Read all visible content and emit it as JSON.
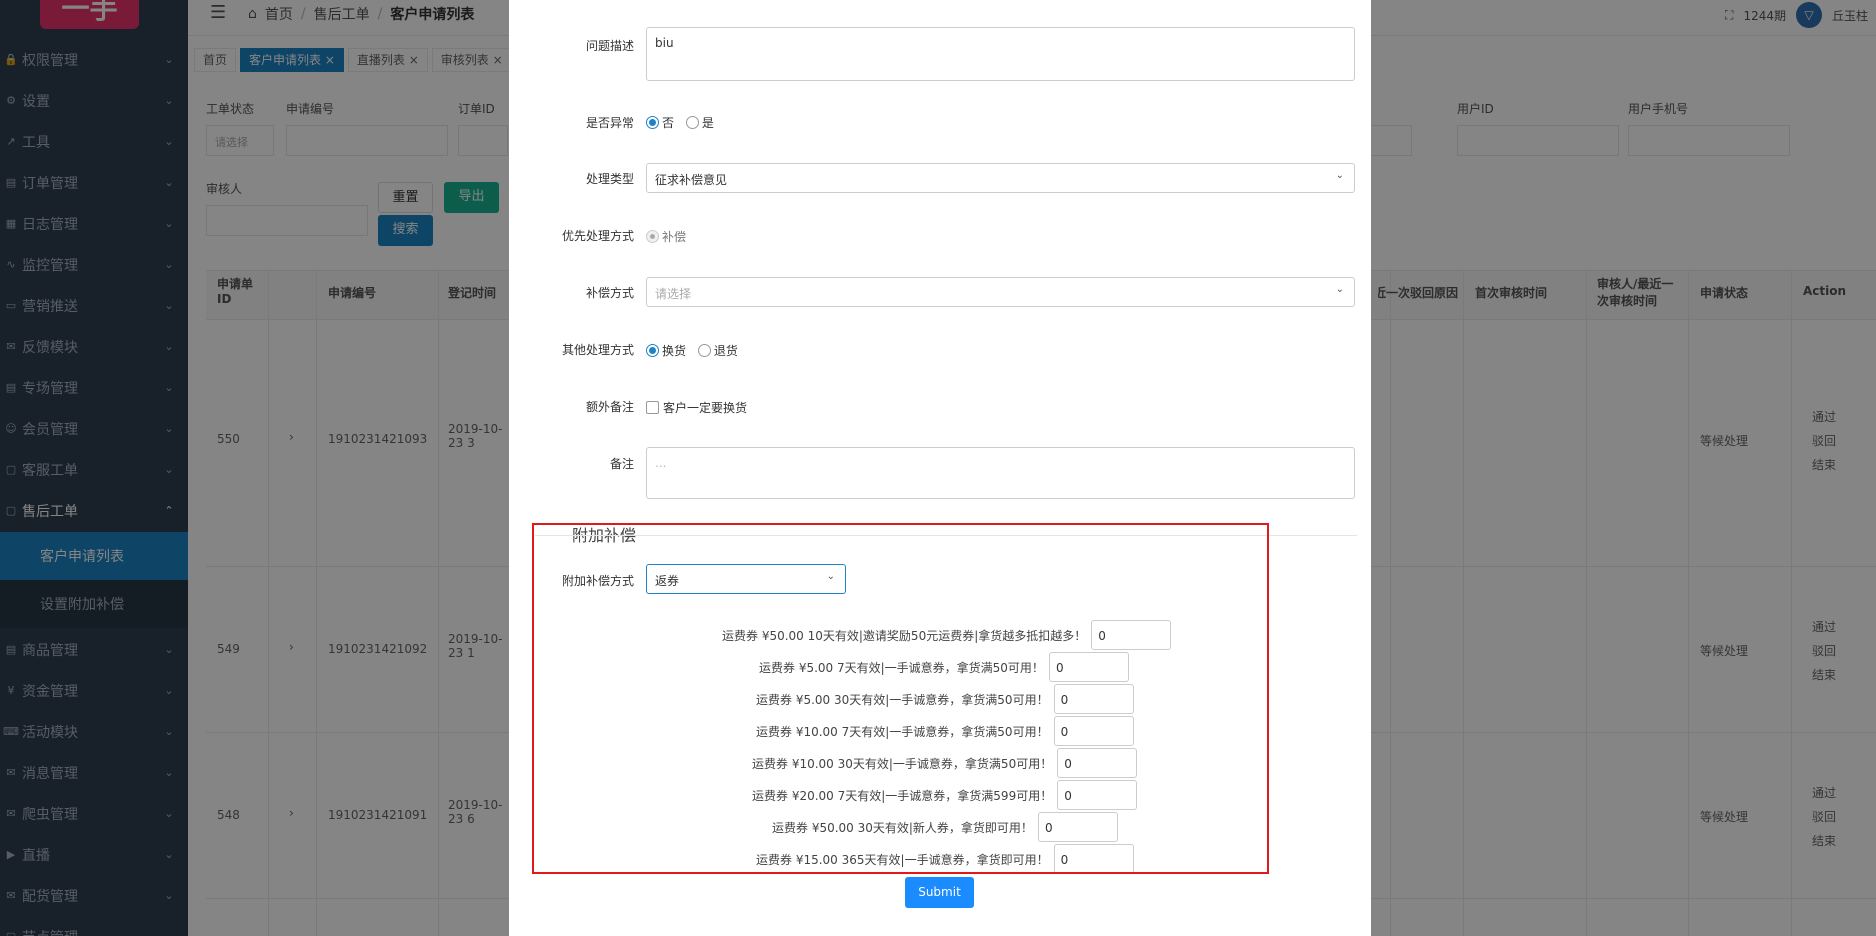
{
  "logo": "一手",
  "sidebar": {
    "items": [
      {
        "icon": "lock-icon",
        "glyph": "🔒",
        "label": "权限管理"
      },
      {
        "icon": "gear-icon",
        "glyph": "⚙",
        "label": "设置"
      },
      {
        "icon": "wrench-icon",
        "glyph": "↗",
        "label": "工具"
      },
      {
        "icon": "order-icon",
        "glyph": "▤",
        "label": "订单管理"
      },
      {
        "icon": "log-icon",
        "glyph": "▦",
        "label": "日志管理"
      },
      {
        "icon": "monitor-icon",
        "glyph": "∿",
        "label": "监控管理"
      },
      {
        "icon": "card-icon",
        "glyph": "▭",
        "label": "营销推送"
      },
      {
        "icon": "feedback-icon",
        "glyph": "✉",
        "label": "反馈模块"
      },
      {
        "icon": "venue-icon",
        "glyph": "▤",
        "label": "专场管理"
      },
      {
        "icon": "member-icon",
        "glyph": "☺",
        "label": "会员管理"
      },
      {
        "icon": "service-icon",
        "glyph": "▢",
        "label": "客服工单"
      },
      {
        "icon": "aftersale-icon",
        "glyph": "▢",
        "label": "售后工单"
      },
      {
        "icon": "goods-icon",
        "glyph": "▤",
        "label": "商品管理"
      },
      {
        "icon": "yen-icon",
        "glyph": "¥",
        "label": "资金管理"
      },
      {
        "icon": "gamepad-icon",
        "glyph": "⌨",
        "label": "活动模块"
      },
      {
        "icon": "message-icon",
        "glyph": "✉",
        "label": "消息管理"
      },
      {
        "icon": "crawler-icon",
        "glyph": "✉",
        "label": "爬虫管理"
      },
      {
        "icon": "live-icon",
        "glyph": "▶",
        "label": "直播"
      },
      {
        "icon": "delivery-icon",
        "glyph": "✉",
        "label": "配货管理"
      },
      {
        "icon": "more-icon",
        "glyph": "▢",
        "label": "节点管理"
      }
    ],
    "subitems": [
      {
        "label": "客户申请列表"
      },
      {
        "label": "设置附加补偿"
      }
    ]
  },
  "topbar": {
    "crumbs": [
      "首页",
      "售后工单",
      "客户申请列表"
    ],
    "period": "1244期",
    "user": "丘玉柱",
    "avatar_text": "▽"
  },
  "tabs": [
    "首页",
    "客户申请列表 ×",
    "直播列表 ×",
    "审核列表 ×"
  ],
  "filters": {
    "status_label": "工单状态",
    "status_placeholder": "请选择",
    "apply_no_label": "申请编号",
    "order_id_label": "订单ID",
    "user_id_label": "用户ID",
    "user_phone_label": "用户手机号",
    "reviewer_label": "审核人",
    "reset": "重置",
    "export": "导出",
    "search": "搜索"
  },
  "table": {
    "headers": [
      "申请单ID",
      "申请编号",
      "登记时间",
      "近一次驳回原因",
      "首次审核时间",
      "审核人/最近一次审核时间",
      "申请状态",
      "Action"
    ],
    "rows": [
      {
        "id": "550",
        "no": "1910231421093",
        "time": "2019-10-23 3",
        "status": "等候处理",
        "actions": [
          "通过",
          "驳回",
          "结束"
        ]
      },
      {
        "id": "549",
        "no": "1910231421092",
        "time": "2019-10-23 1",
        "status": "等候处理",
        "actions": [
          "通过",
          "驳回",
          "结束"
        ]
      },
      {
        "id": "548",
        "no": "1910231421091",
        "time": "2019-10-23 6",
        "status": "等候处理",
        "actions": [
          "通过",
          "驳回",
          "结束"
        ]
      }
    ]
  },
  "modal": {
    "problem_label": "问题描述",
    "problem_value": "biu",
    "abnormal_label": "是否异常",
    "abnormal_no": "否",
    "abnormal_yes": "是",
    "process_type_label": "处理类型",
    "process_type_value": "征求补偿意见",
    "priority_label": "优先处理方式",
    "priority_value": "补偿",
    "comp_method_label": "补偿方式",
    "comp_method_placeholder": "请选择",
    "other_label": "其他处理方式",
    "other_exchange": "换货",
    "other_return": "退货",
    "extra_note_label": "额外备注",
    "extra_note_check": "客户一定要换货",
    "note_label": "备注",
    "note_placeholder": "...",
    "section_title": "附加补偿",
    "extra_comp_label": "附加补偿方式",
    "extra_comp_value": "返券",
    "submit": "Submit",
    "coupons": [
      {
        "text": "运费券 ¥50.00 10天有效|邀请奖励50元运费券|拿货越多抵扣越多！",
        "qty": "0"
      },
      {
        "text": "运费券 ¥5.00 7天有效|一手诚意券，拿货满50可用！",
        "qty": "0"
      },
      {
        "text": "运费券 ¥5.00 30天有效|一手诚意券，拿货满50可用！",
        "qty": "0"
      },
      {
        "text": "运费券 ¥10.00 7天有效|一手诚意券，拿货满50可用！",
        "qty": "0"
      },
      {
        "text": "运费券 ¥10.00 30天有效|一手诚意券，拿货满50可用！",
        "qty": "0"
      },
      {
        "text": "运费券 ¥20.00 7天有效|一手诚意券，拿货满599可用！",
        "qty": "0"
      },
      {
        "text": "运费券 ¥50.00 30天有效|新人券，拿货即可用！",
        "qty": "0"
      },
      {
        "text": "运费券 ¥15.00 365天有效|一手诚意券，拿货即可用！",
        "qty": "0"
      }
    ]
  }
}
